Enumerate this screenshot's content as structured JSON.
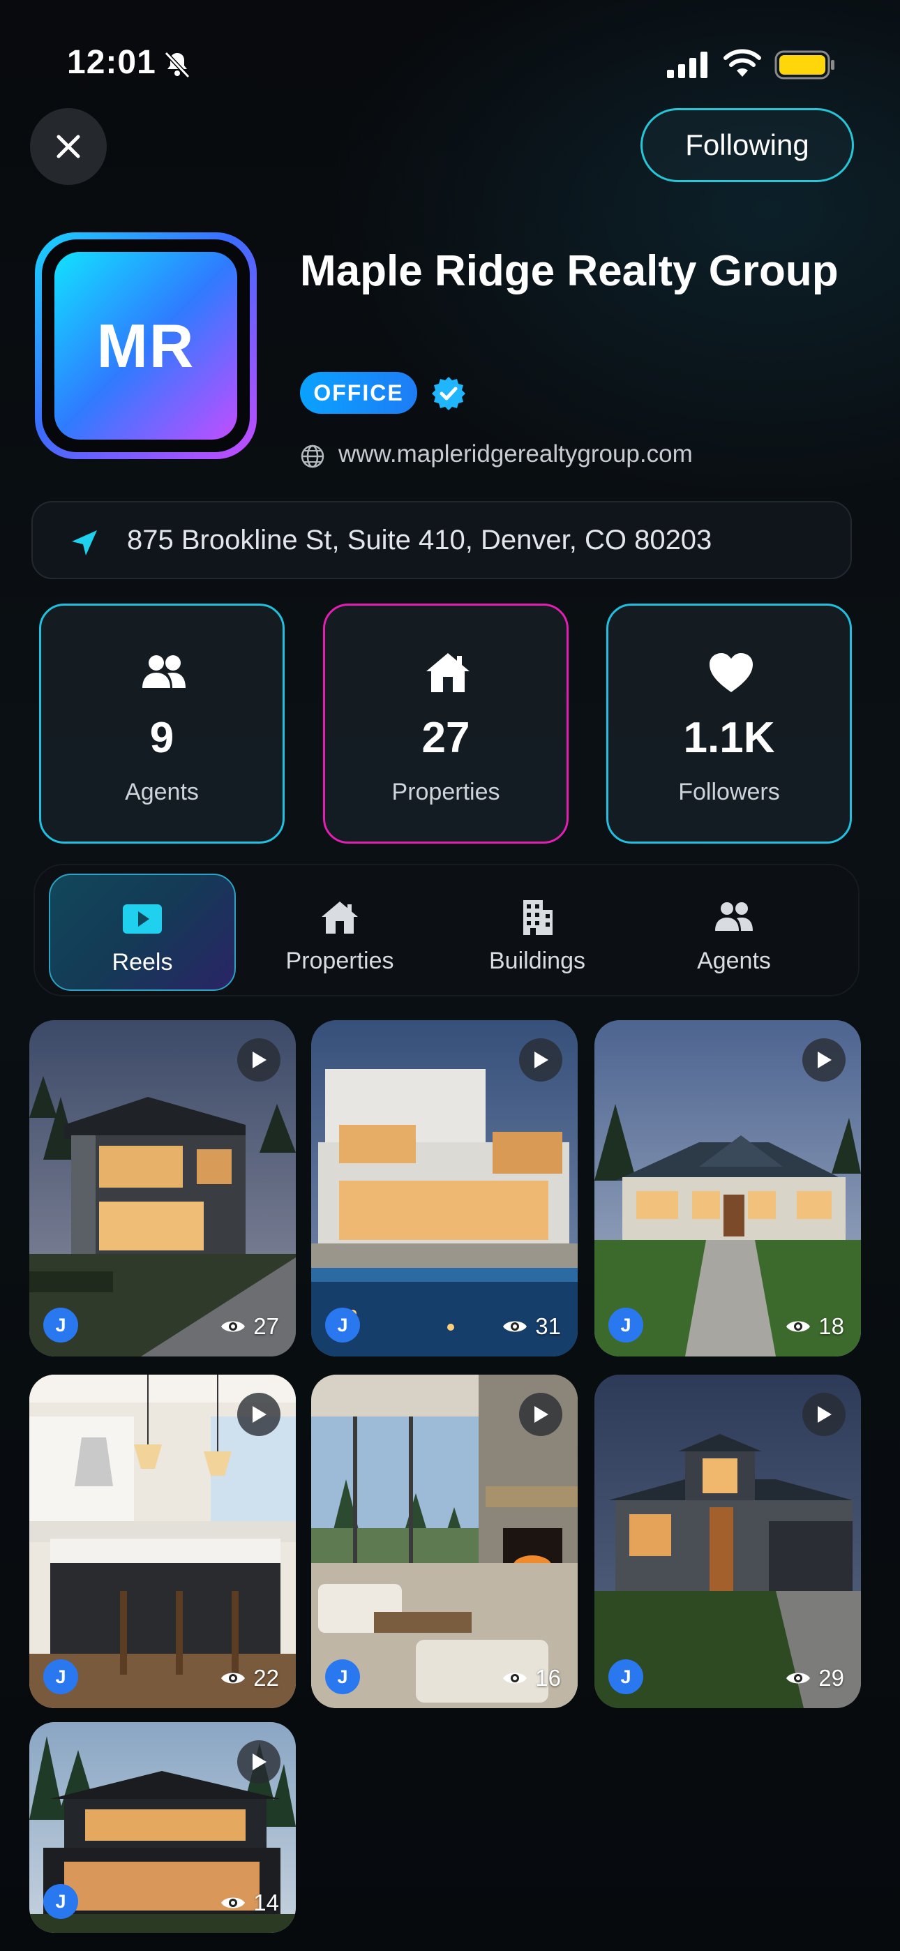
{
  "status_bar": {
    "time": "12:01"
  },
  "header": {
    "following_label": "Following"
  },
  "profile": {
    "logo_initials": "MR",
    "name": "Maple Ridge Realty Group",
    "badge": "OFFICE",
    "website": "www.mapleridgerealtygroup.com",
    "address": "875 Brookline St, Suite 410, Denver, CO 80203"
  },
  "stats": [
    {
      "value": "9",
      "label": "Agents",
      "icon": "people-icon"
    },
    {
      "value": "27",
      "label": "Properties",
      "icon": "home-icon"
    },
    {
      "value": "1.1K",
      "label": "Followers",
      "icon": "heart-icon"
    }
  ],
  "tabs": [
    {
      "label": "Reels",
      "icon": "play-box-icon",
      "active": true
    },
    {
      "label": "Properties",
      "icon": "home-icon",
      "active": false
    },
    {
      "label": "Buildings",
      "icon": "building-icon",
      "active": false
    },
    {
      "label": "Agents",
      "icon": "people-icon",
      "active": false
    }
  ],
  "reels": [
    {
      "avatar": "J",
      "views": "27",
      "scene": "modern-two-story-dusk"
    },
    {
      "avatar": "J",
      "views": "31",
      "scene": "white-modern-pool"
    },
    {
      "avatar": "J",
      "views": "18",
      "scene": "craftsman-lawn"
    },
    {
      "avatar": "J",
      "views": "22",
      "scene": "kitchen-island"
    },
    {
      "avatar": "J",
      "views": "16",
      "scene": "living-room-fireplace"
    },
    {
      "avatar": "J",
      "views": "29",
      "scene": "prairie-home-dusk"
    },
    {
      "avatar": "J",
      "views": "14",
      "scene": "dark-cabin-forest"
    }
  ],
  "colors": {
    "accent_cyan": "#21bfe0",
    "accent_magenta": "#e21fb2",
    "badge_blue": "#0aa2ff",
    "avatar_blue": "#2a78f0"
  }
}
